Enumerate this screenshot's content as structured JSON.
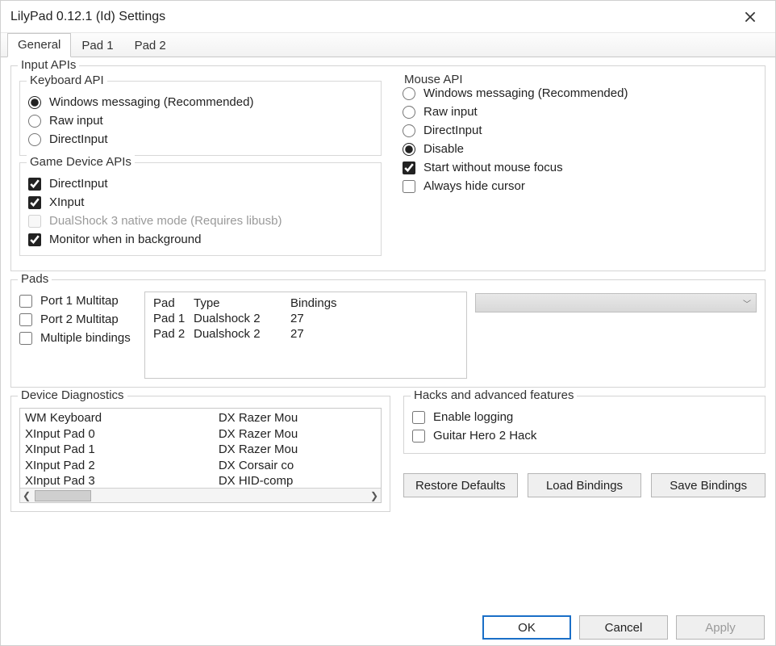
{
  "window": {
    "title": "LilyPad 0.12.1 (Id) Settings"
  },
  "tabs": [
    "General",
    "Pad 1",
    "Pad 2"
  ],
  "groups": {
    "input_apis": "Input APIs",
    "keyboard_api": "Keyboard API",
    "game_device_apis": "Game Device APIs",
    "mouse_api": "Mouse API",
    "pads": "Pads",
    "device_diag": "Device Diagnostics",
    "hacks": "Hacks and advanced features"
  },
  "keyboard_api": {
    "wm": "Windows messaging (Recommended)",
    "raw": "Raw input",
    "di": "DirectInput"
  },
  "game_device": {
    "di": "DirectInput",
    "xi": "XInput",
    "ds3": "DualShock 3 native mode (Requires libusb)",
    "monitor": "Monitor when in background"
  },
  "mouse_api": {
    "wm": "Windows messaging (Recommended)",
    "raw": "Raw input",
    "di": "DirectInput",
    "disable": "Disable",
    "start_nofocus": "Start without mouse focus",
    "hide_cursor": "Always hide cursor"
  },
  "pads": {
    "p1multitap": "Port 1 Multitap",
    "p2multitap": "Port 2 Multitap",
    "multibind": "Multiple bindings",
    "headers": {
      "pad": "Pad",
      "type": "Type",
      "bindings": "Bindings"
    },
    "rows": [
      {
        "pad": "Pad 1",
        "type": "Dualshock 2",
        "bindings": "27"
      },
      {
        "pad": "Pad 2",
        "type": "Dualshock 2",
        "bindings": "27"
      }
    ]
  },
  "diag": {
    "left": [
      "WM Keyboard",
      "XInput Pad 0",
      "XInput Pad 1",
      "XInput Pad 2",
      "XInput Pad 3"
    ],
    "right": [
      "DX Razer Mou",
      "DX Razer Mou",
      "DX Razer Mou",
      "DX Corsair co",
      "DX HID-comp"
    ]
  },
  "hacks": {
    "logging": "Enable logging",
    "gh2": "Guitar Hero 2 Hack"
  },
  "buttons": {
    "restore": "Restore Defaults",
    "load": "Load Bindings",
    "save": "Save Bindings",
    "ok": "OK",
    "cancel": "Cancel",
    "apply": "Apply"
  }
}
